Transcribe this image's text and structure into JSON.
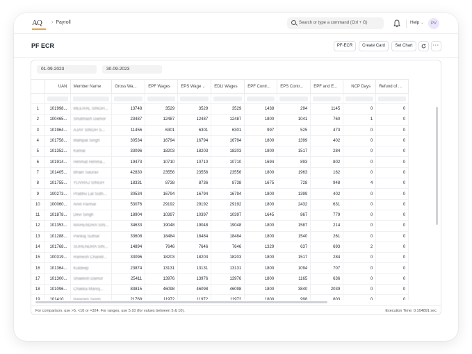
{
  "navbar": {
    "logo": "AQ",
    "breadcrumb": "Payroll",
    "search_placeholder": "Search or type a command (Ctrl + G)",
    "help_label": "Help",
    "avatar_initials": "PV"
  },
  "page": {
    "title": "PF ECR",
    "buttons": [
      "PF-ECR",
      "Create Card",
      "Set Chart"
    ]
  },
  "filters": {
    "from_date": "01-09-2023",
    "to_date": "30-09-2023"
  },
  "table": {
    "columns": [
      "",
      "UAN",
      "Member Name",
      "Gross Wa...",
      "EPF Wages",
      "EPS Wage",
      "EDLI Wages",
      "EPF Contr...",
      "EPS Contr...",
      "EPF and E...",
      "NCP Days",
      "Refund of ..."
    ],
    "rows": [
      [
        "1",
        "101998...",
        "MEERAL SINGH...",
        "13748",
        "3529",
        "3529",
        "3529",
        "1438",
        "294",
        "1145",
        "0",
        "0"
      ],
      [
        "2",
        "100465...",
        "Shubhash Damor",
        "23487",
        "12487",
        "12487",
        "12487",
        "1800",
        "1041",
        "760",
        "1",
        "0"
      ],
      [
        "3",
        "101964...",
        "AJAY SINGH S...",
        "11456",
        "6301",
        "6301",
        "6301",
        "997",
        "525",
        "473",
        "0",
        "0"
      ],
      [
        "4",
        "101758...",
        "Mahipal Singh",
        "30534",
        "16794",
        "16794",
        "16794",
        "1800",
        "1399",
        "402",
        "0",
        "0"
      ],
      [
        "5",
        "101352...",
        "Kamal",
        "33096",
        "18203",
        "18203",
        "18203",
        "1800",
        "1517",
        "284",
        "0",
        "0"
      ],
      [
        "6",
        "101914...",
        "Himmat Himma...",
        "19473",
        "10710",
        "10710",
        "10710",
        "1694",
        "893",
        "802",
        "0",
        "0"
      ],
      [
        "7",
        "101405...",
        "Bhairi Saurav",
        "42830",
        "23556",
        "23556",
        "23556",
        "1800",
        "1963",
        "162",
        "0",
        "0"
      ],
      [
        "8",
        "101755...",
        "YUVRAJ SINGH",
        "18331",
        "8738",
        "8736",
        "8738",
        "1675",
        "728",
        "948",
        "4",
        "0"
      ],
      [
        "9",
        "100273...",
        "Prabhu Lal Suth...",
        "30534",
        "16794",
        "16794",
        "16794",
        "1800",
        "1399",
        "402",
        "0",
        "0"
      ],
      [
        "10",
        "100060...",
        "Amit Parihar",
        "53076",
        "29192",
        "29192",
        "29192",
        "1800",
        "2432",
        "631",
        "0",
        "0"
      ],
      [
        "11",
        "101878...",
        "Devi Singh",
        "18904",
        "10397",
        "10397",
        "10397",
        "1645",
        "867",
        "779",
        "0",
        "0"
      ],
      [
        "12",
        "101353...",
        "MAHENDRA SIN...",
        "34633",
        "19048",
        "19048",
        "19048",
        "1800",
        "1587",
        "214",
        "0",
        "0"
      ],
      [
        "13",
        "101288...",
        "Pankaj Suthar",
        "33608",
        "18484",
        "18484",
        "18484",
        "1800",
        "1540",
        "261",
        "0",
        "0"
      ],
      [
        "14",
        "101768...",
        "SURENDRA SIN...",
        "14894",
        "7646",
        "7646",
        "7646",
        "1329",
        "637",
        "693",
        "2",
        "0"
      ],
      [
        "15",
        "100319...",
        "Ramesh Chandr...",
        "33096",
        "18203",
        "18203",
        "18203",
        "1800",
        "1517",
        "284",
        "0",
        "0"
      ],
      [
        "16",
        "101364...",
        "Kuldeep",
        "23874",
        "13131",
        "13131",
        "13131",
        "1800",
        "1094",
        "707",
        "0",
        "0"
      ],
      [
        "17",
        "101300...",
        "Shailesh Damor",
        "25411",
        "13976",
        "13976",
        "13976",
        "1800",
        "1165",
        "636",
        "0",
        "0"
      ],
      [
        "18",
        "101096...",
        "Chakka Manoj...",
        "83815",
        "46098",
        "46098",
        "46098",
        "1800",
        "3840",
        "2039",
        "0",
        "0"
      ],
      [
        "19",
        "101410...",
        "Balaram Singh",
        "21768",
        "11972",
        "11972",
        "11972",
        "1800",
        "998",
        "803",
        "0",
        "0"
      ]
    ]
  },
  "footer": {
    "hint": "For comparison, use >5, <10 or =324. For ranges, use 5:10 (for values between 5 & 10).",
    "execution": "Execution Time: 0.104891 sec"
  }
}
